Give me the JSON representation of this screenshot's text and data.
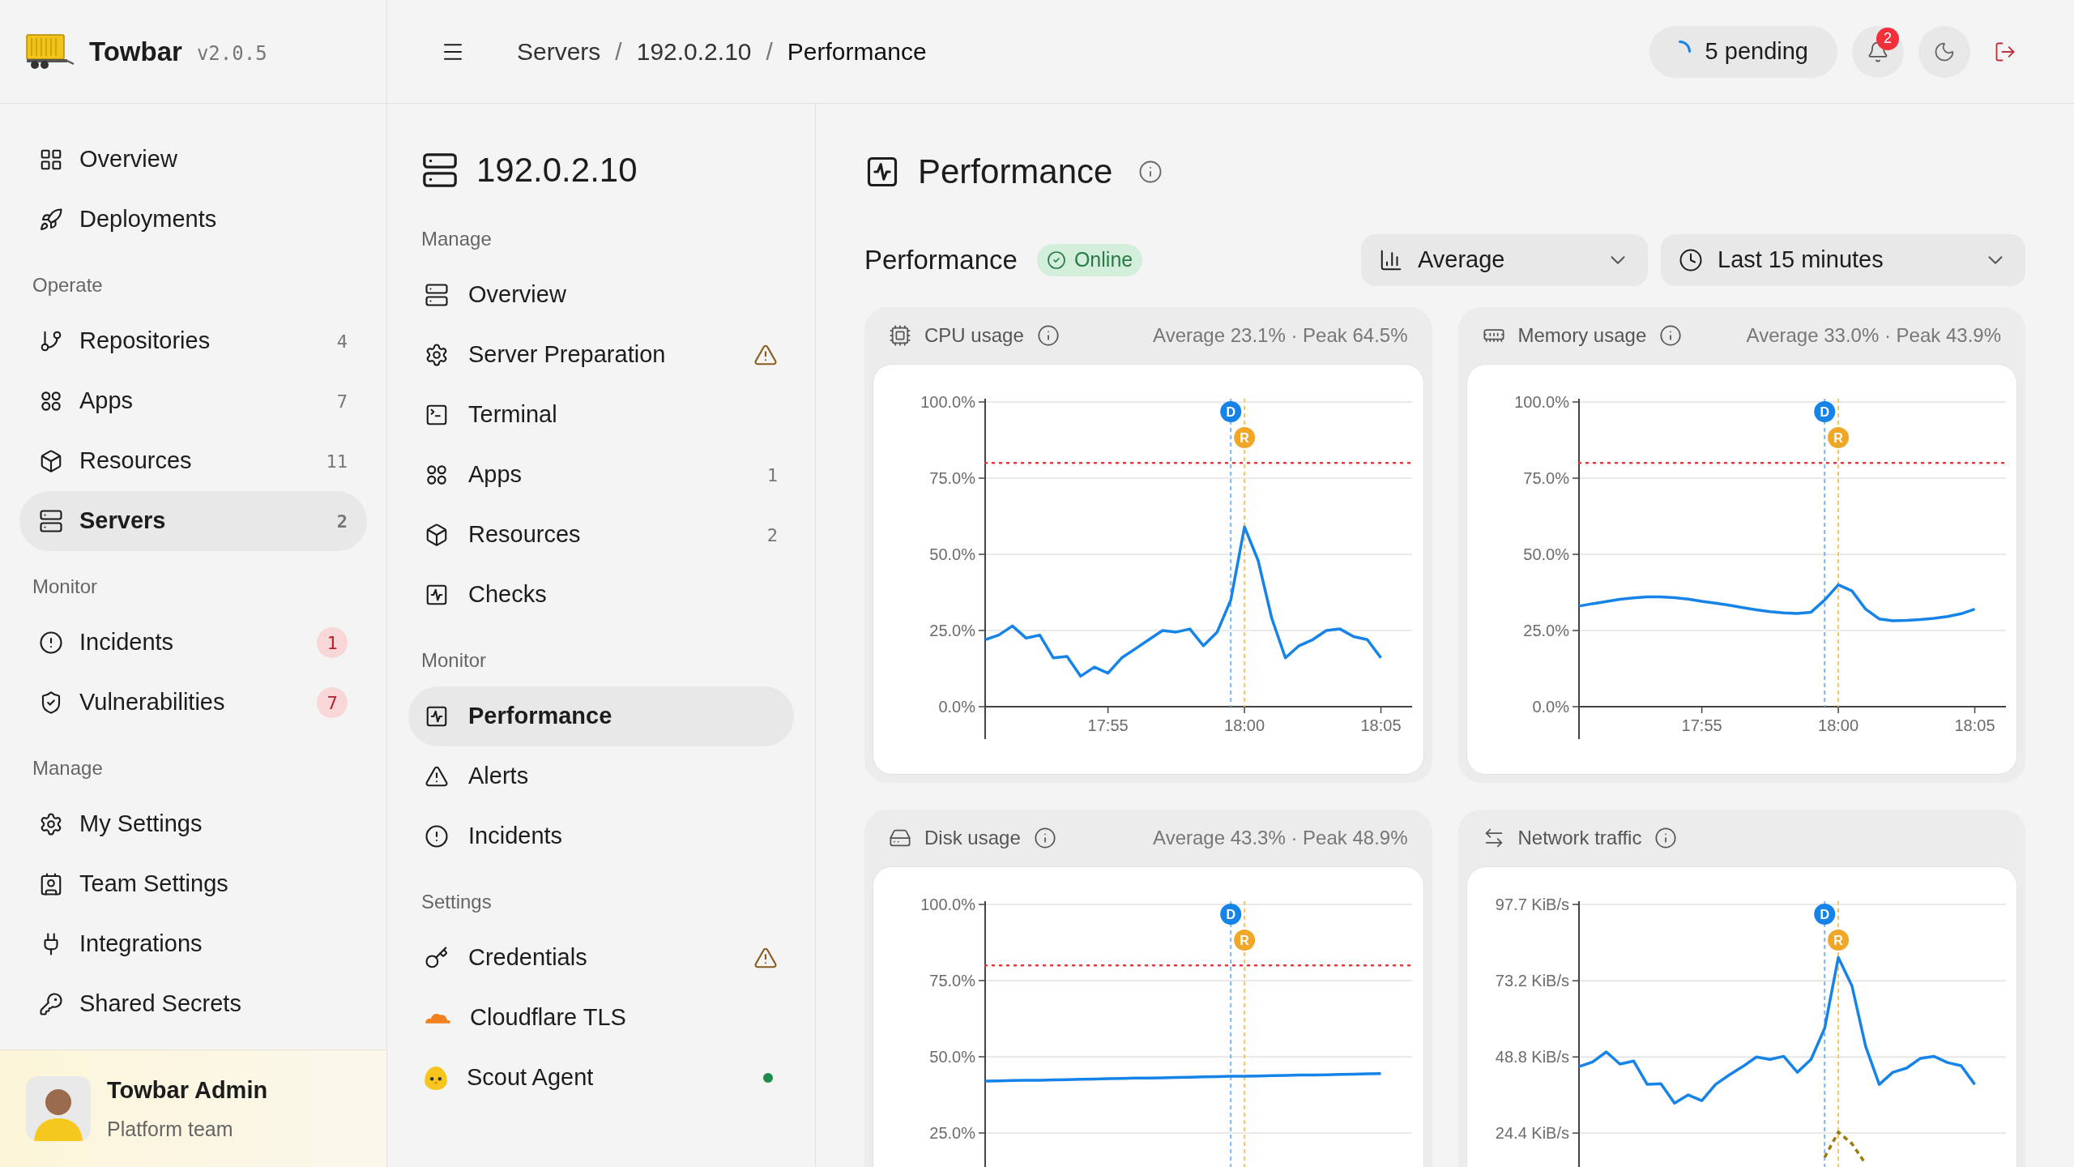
{
  "app": {
    "name": "Towbar",
    "version": "v2.0.5"
  },
  "breadcrumb": {
    "separator": "/",
    "items": [
      "Servers",
      "192.0.2.10",
      "Performance"
    ]
  },
  "topbar": {
    "pending": "5 pending",
    "notifications": "2"
  },
  "sidebar": {
    "sections": [
      {
        "items": [
          {
            "label": "Overview",
            "selected": false
          },
          {
            "label": "Deployments",
            "selected": false
          }
        ]
      },
      {
        "heading": "Operate",
        "items": [
          {
            "label": "Repositories",
            "count": "4",
            "highlighted": false,
            "selected": false
          },
          {
            "label": "Apps",
            "count": "7",
            "highlighted": false,
            "selected": false
          },
          {
            "label": "Resources",
            "count": "11",
            "highlighted": false,
            "selected": false
          },
          {
            "label": "Servers",
            "count": "2",
            "highlighted": false,
            "selected": true
          }
        ]
      },
      {
        "heading": "Monitor",
        "items": [
          {
            "label": "Incidents",
            "count": "1",
            "highlighted": true,
            "selected": false
          },
          {
            "label": "Vulnerabilities",
            "count": "7",
            "highlighted": true,
            "selected": false
          }
        ]
      },
      {
        "heading": "Manage",
        "items": [
          {
            "label": "My Settings",
            "selected": false
          },
          {
            "label": "Team Settings",
            "selected": false
          },
          {
            "label": "Integrations",
            "selected": false
          },
          {
            "label": "Shared Secrets",
            "selected": false
          }
        ]
      }
    ],
    "user": {
      "name": "Towbar Admin",
      "team": "Platform team"
    }
  },
  "server_nav": {
    "title": "192.0.2.10",
    "sections": [
      {
        "heading": "Manage",
        "items": [
          {
            "label": "Overview",
            "warning": false,
            "online": false,
            "selected": false
          },
          {
            "label": "Server Preparation",
            "warning": true,
            "online": false,
            "selected": false
          },
          {
            "label": "Terminal",
            "warning": false,
            "online": false,
            "selected": false
          },
          {
            "label": "Apps",
            "count": "1",
            "warning": false,
            "online": false,
            "selected": false
          },
          {
            "label": "Resources",
            "count": "2",
            "warning": false,
            "online": false,
            "selected": false
          },
          {
            "label": "Checks",
            "warning": false,
            "online": false,
            "selected": false
          }
        ]
      },
      {
        "heading": "Monitor",
        "items": [
          {
            "label": "Performance",
            "warning": false,
            "online": false,
            "selected": true
          },
          {
            "label": "Alerts",
            "warning": false,
            "online": false,
            "selected": false
          },
          {
            "label": "Incidents",
            "warning": false,
            "online": false,
            "selected": false
          }
        ]
      },
      {
        "heading": "Settings",
        "items": [
          {
            "label": "Credentials",
            "warning": true,
            "online": false,
            "selected": false
          },
          {
            "label": "Cloudflare TLS",
            "warning": false,
            "online": false,
            "selected": false
          },
          {
            "label": "Scout Agent",
            "warning": false,
            "online": true,
            "selected": false
          }
        ]
      }
    ]
  },
  "page": {
    "title": "Performance",
    "section_title": "Performance",
    "status": "Online",
    "filters": [
      {
        "value": "Average"
      },
      {
        "value": "Last 15 minutes"
      }
    ]
  },
  "cards": [
    {
      "title": "CPU usage",
      "summary": "Average 23.1% · Peak 64.5%",
      "chart_data": {
        "type": "line",
        "categories": [
          null,
          null,
          null,
          null,
          null,
          null,
          null,
          null,
          null,
          "17:55",
          null,
          null,
          null,
          null,
          null,
          null,
          null,
          null,
          null,
          "18:00",
          null,
          null,
          null,
          null,
          null,
          null,
          null,
          null,
          null,
          "18:05"
        ],
        "series": [
          {
            "color": "#1683e8",
            "values": [
              22,
              23.5,
              26.5,
              22.5,
              23.5,
              16,
              16.5,
              10,
              13,
              11,
              16,
              19,
              22,
              25,
              24.5,
              25.5,
              20,
              24.5,
              35,
              59,
              48,
              29,
              16,
              20,
              22,
              25,
              25.5,
              23,
              22,
              16
            ]
          }
        ],
        "ylim": [
          0,
          100
        ],
        "yticks": [
          {
            "value": 0,
            "label": "0.0%"
          },
          {
            "value": 25,
            "label": "25.0%"
          },
          {
            "value": 50,
            "label": "50.0%"
          },
          {
            "value": 75,
            "label": "75.0%"
          },
          {
            "value": 100,
            "label": "100.0%"
          }
        ],
        "grid": true,
        "ref_lines": [
          {
            "axis": "y",
            "value": 80
          }
        ],
        "annotations": [
          "D",
          "R"
        ]
      }
    },
    {
      "title": "Memory usage",
      "summary": "Average 33.0% · Peak 43.9%",
      "chart_data": {
        "type": "line",
        "categories": [
          null,
          null,
          null,
          null,
          null,
          null,
          null,
          null,
          null,
          "17:55",
          null,
          null,
          null,
          null,
          null,
          null,
          null,
          null,
          null,
          "18:00",
          null,
          null,
          null,
          null,
          null,
          null,
          null,
          null,
          null,
          "18:05"
        ],
        "series": [
          {
            "color": "#1683e8",
            "values": [
              33,
              33.8,
              34.5,
              35.2,
              35.7,
              36,
              36,
              35.8,
              35.3,
              34.6,
              34,
              33.3,
              32.5,
              31.8,
              31.2,
              30.8,
              30.6,
              31,
              35,
              40,
              38,
              32,
              28.8,
              28.2,
              28.3,
              28.6,
              29,
              29.6,
              30.5,
              32
            ]
          }
        ],
        "ylim": [
          0,
          100
        ],
        "yticks": [
          {
            "value": 0,
            "label": "0.0%"
          },
          {
            "value": 25,
            "label": "25.0%"
          },
          {
            "value": 50,
            "label": "50.0%"
          },
          {
            "value": 75,
            "label": "75.0%"
          },
          {
            "value": 100,
            "label": "100.0%"
          }
        ],
        "grid": true,
        "ref_lines": [
          {
            "axis": "y",
            "value": 80
          }
        ],
        "annotations": [
          "D",
          "R"
        ]
      }
    },
    {
      "title": "Disk usage",
      "summary": "Average 43.3% · Peak 48.9%",
      "chart_data": {
        "type": "line",
        "categories": [
          null,
          null,
          null,
          null,
          null,
          null,
          null,
          null,
          null,
          null,
          null,
          null,
          null,
          null,
          null,
          null,
          null,
          null,
          null,
          null,
          null,
          null,
          null,
          null,
          null,
          null,
          null,
          null,
          null,
          null
        ],
        "series": [
          {
            "color": "#1683e8",
            "values": [
              42,
              42.1,
              42.2,
              42.3,
              42.3,
              42.4,
              42.5,
              42.6,
              42.7,
              42.8,
              42.9,
              43,
              43,
              43.1,
              43.2,
              43.3,
              43.4,
              43.5,
              43.6,
              43.6,
              43.7,
              43.8,
              43.9,
              44,
              44,
              44.1,
              44.2,
              44.3,
              44.4,
              44.5
            ]
          }
        ],
        "ylim": [
          0,
          100
        ],
        "yticks": [
          {
            "value": 25,
            "label": "25.0%"
          },
          {
            "value": 50,
            "label": "50.0%"
          },
          {
            "value": 75,
            "label": "75.0%"
          },
          {
            "value": 100,
            "label": "100.0%"
          }
        ],
        "grid": true,
        "ref_lines": [
          {
            "axis": "y",
            "value": 80
          }
        ],
        "annotations": [
          "D",
          "R"
        ]
      }
    },
    {
      "title": "Network traffic",
      "chart_data": {
        "type": "line",
        "categories": [
          null,
          null,
          null,
          null,
          null,
          null,
          null,
          null,
          null,
          null,
          null,
          null,
          null,
          null,
          null,
          null,
          null,
          null,
          null,
          null,
          null,
          null,
          null,
          null,
          null,
          null,
          null,
          null,
          null,
          null
        ],
        "series": [
          {
            "color": "#1683e8",
            "line_style": "solid",
            "values": [
              45.7,
              47.2,
              50.4,
              46.5,
              47.5,
              40,
              40.2,
              34,
              36.6,
              34.8,
              40,
              43,
              45.7,
              48.8,
              48,
              49,
              43.9,
              48,
              58,
              80.7,
              71.6,
              52.2,
              40,
              43.9,
              45.2,
              48.3,
              49,
              47,
              46,
              40
            ]
          },
          {
            "color": "#9c7a0c",
            "line_style": "dashed",
            "values": [
              null,
              null,
              null,
              null,
              null,
              null,
              null,
              null,
              null,
              null,
              null,
              null,
              null,
              null,
              null,
              null,
              null,
              null,
              16.6,
              24.7,
              21,
              14.5,
              null,
              null,
              null,
              null,
              null,
              null,
              null,
              null
            ]
          }
        ],
        "ylim": [
          0,
          97.7
        ],
        "yticks": [
          {
            "value": 24.4,
            "label": "24.4 KiB/s"
          },
          {
            "value": 48.8,
            "label": "48.8 KiB/s"
          },
          {
            "value": 73.2,
            "label": "73.2 KiB/s"
          },
          {
            "value": 97.7,
            "label": "97.7 KiB/s"
          }
        ],
        "grid": true,
        "annotations": [
          "D",
          "R"
        ]
      }
    }
  ]
}
